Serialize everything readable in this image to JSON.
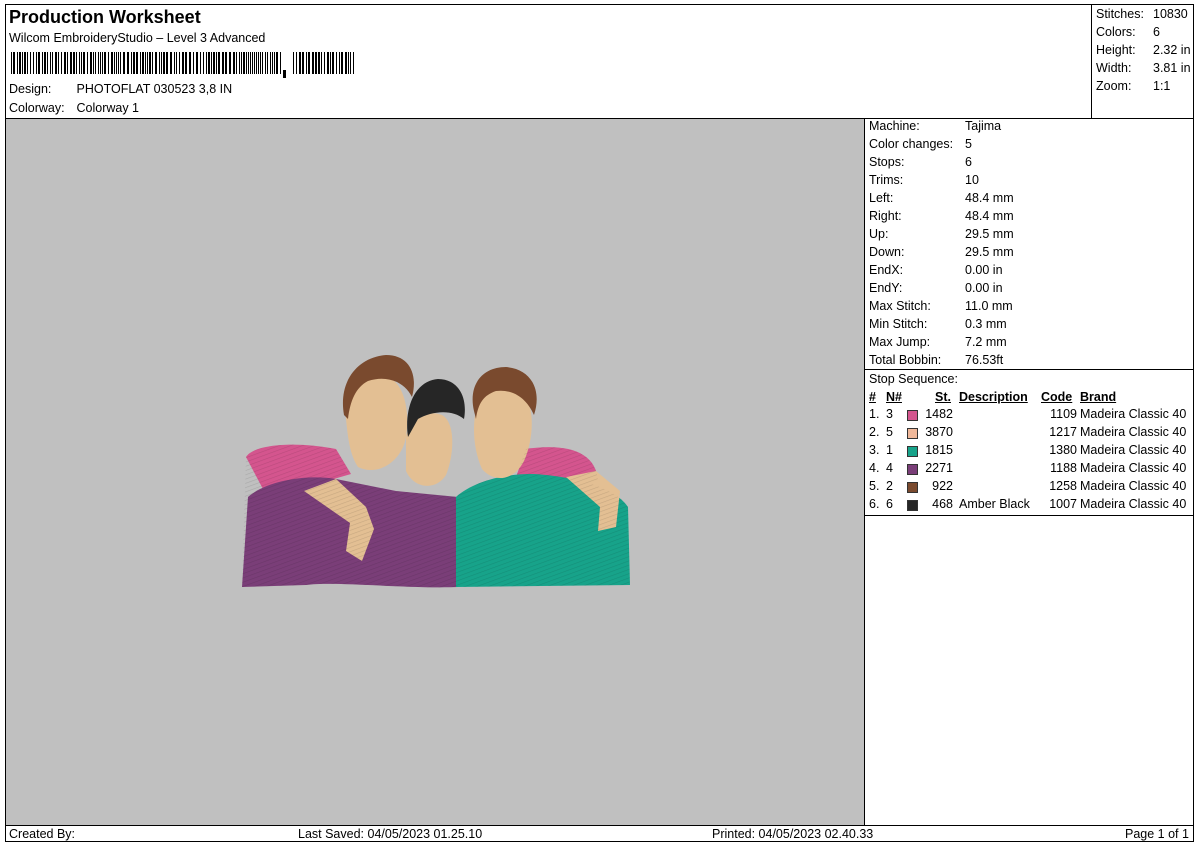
{
  "header": {
    "title": "Production Worksheet",
    "subtitle": "Wilcom EmbroideryStudio – Level 3 Advanced",
    "design_label": "Design:",
    "design_value": "PHOTOFLAT 030523 3,8 IN",
    "colorway_label": "Colorway:",
    "colorway_value": "Colorway 1"
  },
  "summary": {
    "stitches_label": "Stitches:",
    "stitches": "10830",
    "colors_label": "Colors:",
    "colors": "6",
    "height_label": "Height:",
    "height": "2.32 in",
    "width_label": "Width:",
    "width": "3.81 in",
    "zoom_label": "Zoom:",
    "zoom": "1:1"
  },
  "machine_info": [
    {
      "label": "Machine:",
      "value": "Tajima"
    },
    {
      "label": "Color changes:",
      "value": "5"
    },
    {
      "label": "Stops:",
      "value": "6"
    },
    {
      "label": "Trims:",
      "value": "10"
    },
    {
      "label": "Left:",
      "value": "48.4 mm"
    },
    {
      "label": "Right:",
      "value": "48.4 mm"
    },
    {
      "label": "Up:",
      "value": "29.5 mm"
    },
    {
      "label": "Down:",
      "value": "29.5 mm"
    },
    {
      "label": "EndX:",
      "value": "0.00 in"
    },
    {
      "label": "EndY:",
      "value": "0.00 in"
    },
    {
      "label": "Max Stitch:",
      "value": "11.0 mm"
    },
    {
      "label": "Min Stitch:",
      "value": "0.3 mm"
    },
    {
      "label": "Max Jump:",
      "value": "7.2 mm"
    },
    {
      "label": "Total Bobbin:",
      "value": "76.53ft"
    }
  ],
  "stop_sequence": {
    "title": "Stop Sequence:",
    "headers": {
      "idx": "#",
      "n": "N#",
      "st": "St.",
      "desc": "Description",
      "code": "Code",
      "brand": "Brand"
    },
    "rows": [
      {
        "idx": "1.",
        "n": "3",
        "color": "#d4558e",
        "st": "1482",
        "desc": "",
        "code": "1109",
        "brand": "Madeira Classic 40"
      },
      {
        "idx": "2.",
        "n": "5",
        "color": "#f0b89a",
        "st": "3870",
        "desc": "",
        "code": "1217",
        "brand": "Madeira Classic 40"
      },
      {
        "idx": "3.",
        "n": "1",
        "color": "#17a38a",
        "st": "1815",
        "desc": "",
        "code": "1380",
        "brand": "Madeira Classic 40"
      },
      {
        "idx": "4.",
        "n": "4",
        "color": "#7a3e78",
        "st": "2271",
        "desc": "",
        "code": "1188",
        "brand": "Madeira Classic 40"
      },
      {
        "idx": "5.",
        "n": "2",
        "color": "#7a4a2e",
        "st": "922",
        "desc": "",
        "code": "1258",
        "brand": "Madeira Classic 40"
      },
      {
        "idx": "6.",
        "n": "6",
        "color": "#262626",
        "st": "468",
        "desc": "Amber Black",
        "code": "1007",
        "brand": "Madeira Classic 40"
      }
    ]
  },
  "footer": {
    "created_by": "Created By:",
    "last_saved": "Last Saved: 04/05/2023 01.25.10",
    "printed": "Printed: 04/05/2023 02.40.33",
    "page": "Page 1 of 1"
  }
}
